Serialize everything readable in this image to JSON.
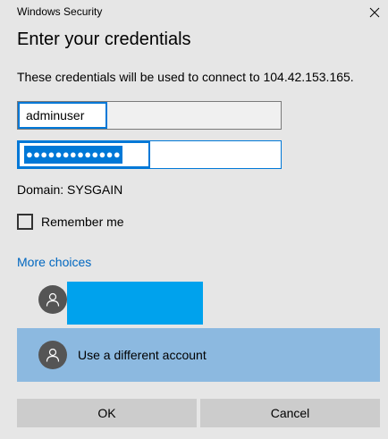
{
  "window": {
    "title": "Windows Security"
  },
  "dialog": {
    "heading": "Enter your credentials",
    "description": "These credentials will be used to connect to 104.42.153.165."
  },
  "fields": {
    "username_value": "adminuser",
    "password_masked": "●●●●●●●●●●●●●"
  },
  "domain_text": "Domain: SYSGAIN",
  "remember": {
    "label": "Remember me",
    "checked": false
  },
  "more_choices_label": "More choices",
  "accounts": [
    {
      "label": ""
    },
    {
      "label": "Use a different account"
    }
  ],
  "buttons": {
    "ok_label": "OK",
    "cancel_label": "Cancel"
  },
  "colors": {
    "background": "#e6e6e6",
    "accent": "#0078d7",
    "link": "#0067c0",
    "selected_row": "#8cb9e0",
    "redaction": "#00a2ed",
    "button": "#cccccc"
  },
  "icons": {
    "close": "close-icon",
    "avatar": "user-avatar-icon"
  }
}
